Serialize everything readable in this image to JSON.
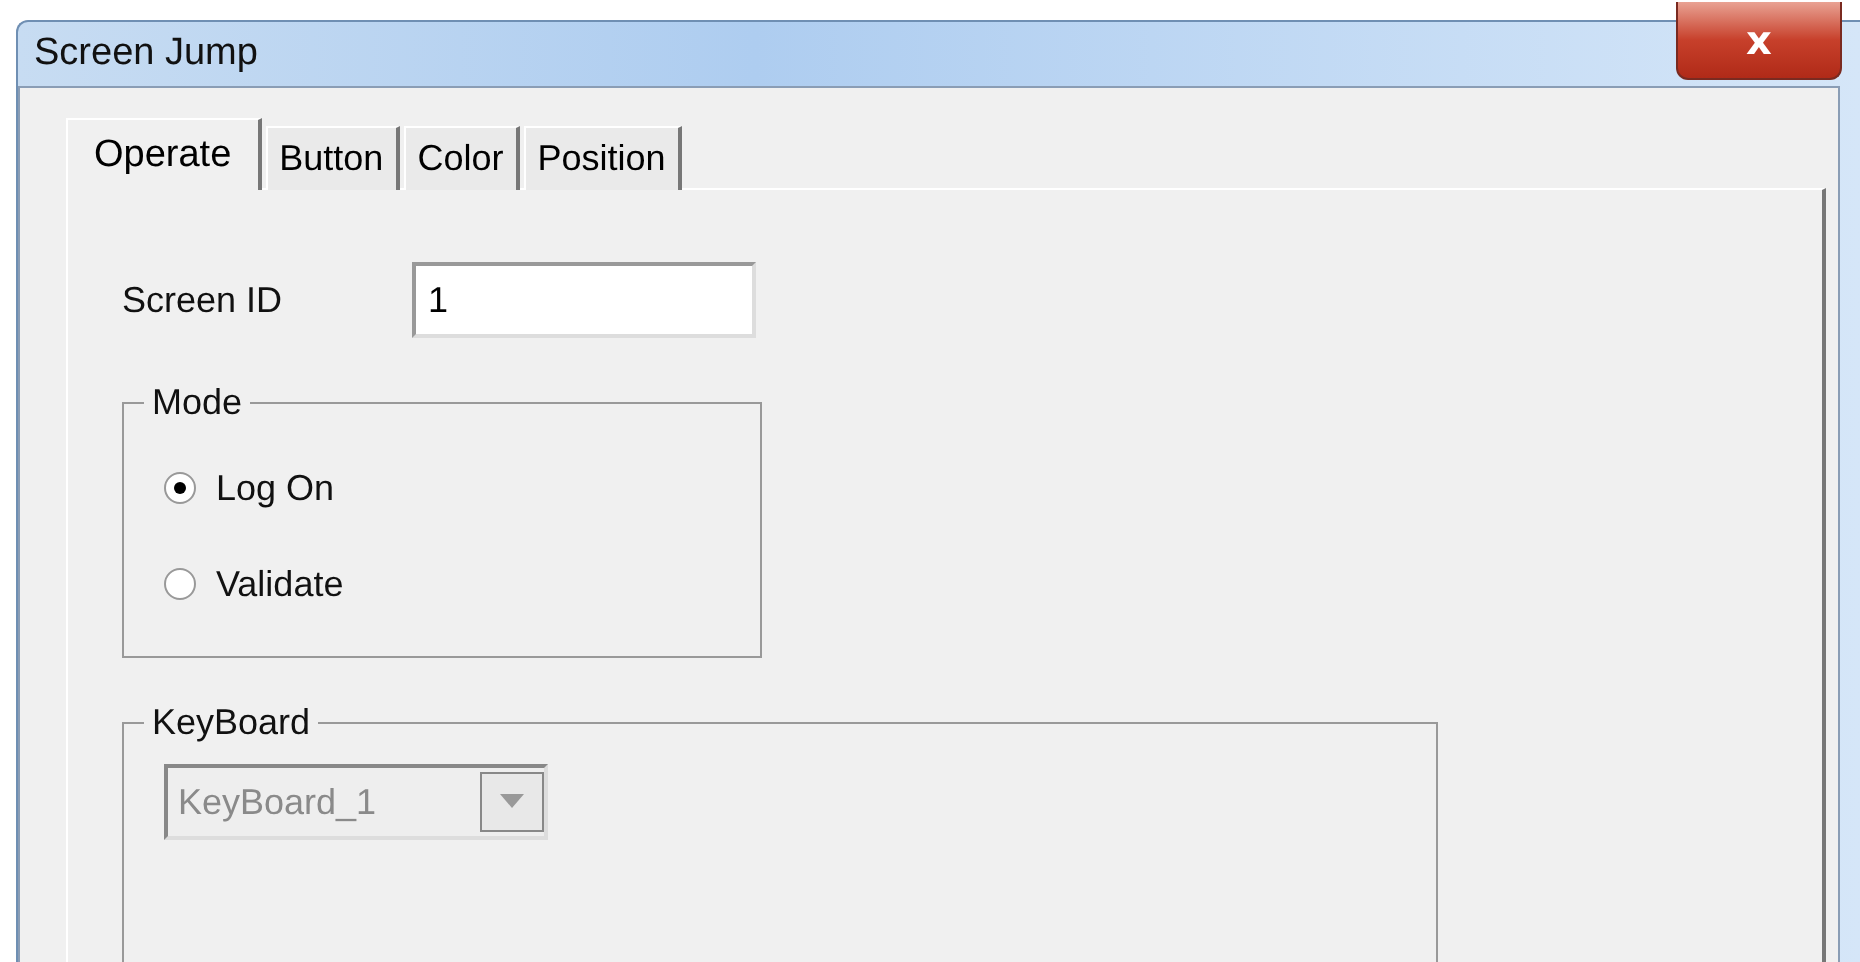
{
  "window": {
    "title": "Screen Jump",
    "close_label": "x"
  },
  "tabs": [
    {
      "label": "Operate",
      "selected": true
    },
    {
      "label": "Button",
      "selected": false
    },
    {
      "label": "Color",
      "selected": false
    },
    {
      "label": "Position",
      "selected": false
    }
  ],
  "screen_id": {
    "label": "Screen ID",
    "value": "1"
  },
  "mode": {
    "title": "Mode",
    "options": [
      {
        "label": "Log On",
        "selected": true
      },
      {
        "label": "Validate",
        "selected": false
      }
    ]
  },
  "keyboard": {
    "title": "KeyBoard",
    "value": "KeyBoard_1",
    "disabled": true
  }
}
